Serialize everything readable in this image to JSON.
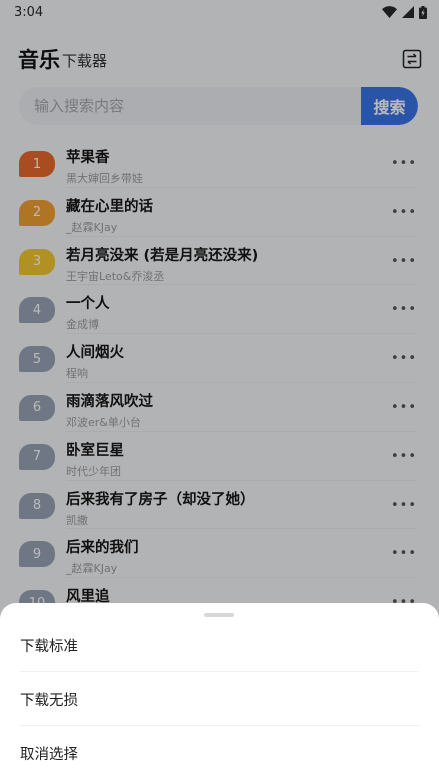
{
  "status_bar": {
    "time": "3:04"
  },
  "header": {
    "title": "音乐",
    "subtitle": "下载器",
    "swap_icon": "swap-arrows-icon"
  },
  "search": {
    "placeholder": "输入搜索内容",
    "button_label": "搜索"
  },
  "colors": {
    "rank1": "#e86a2c",
    "rank2": "#f0a032",
    "rank3": "#f3c731",
    "rank_default": "#9aa4b6",
    "accent": "#3a74e6"
  },
  "songs": [
    {
      "rank": "1",
      "title": "苹果香",
      "artist": "黑大婶回乡带娃"
    },
    {
      "rank": "2",
      "title": "藏在心里的话",
      "artist": "_赵霖KJay"
    },
    {
      "rank": "3",
      "title": "若月亮没来 (若是月亮还没来)",
      "artist": "王宇宙Leto&乔浚丞"
    },
    {
      "rank": "4",
      "title": "一个人",
      "artist": "金成博"
    },
    {
      "rank": "5",
      "title": "人间烟火",
      "artist": "程响"
    },
    {
      "rank": "6",
      "title": "雨滴落风吹过",
      "artist": "邓波er&单小台"
    },
    {
      "rank": "7",
      "title": "卧室巨星",
      "artist": "时代少年团"
    },
    {
      "rank": "8",
      "title": "后来我有了房子（却没了她）",
      "artist": "凯撒"
    },
    {
      "rank": "9",
      "title": "后来的我们",
      "artist": "_赵霖KJay"
    },
    {
      "rank": "10",
      "title": "风里追",
      "artist": ""
    }
  ],
  "sheet": {
    "items": [
      "下载标准",
      "下载无损",
      "取消选择"
    ]
  }
}
